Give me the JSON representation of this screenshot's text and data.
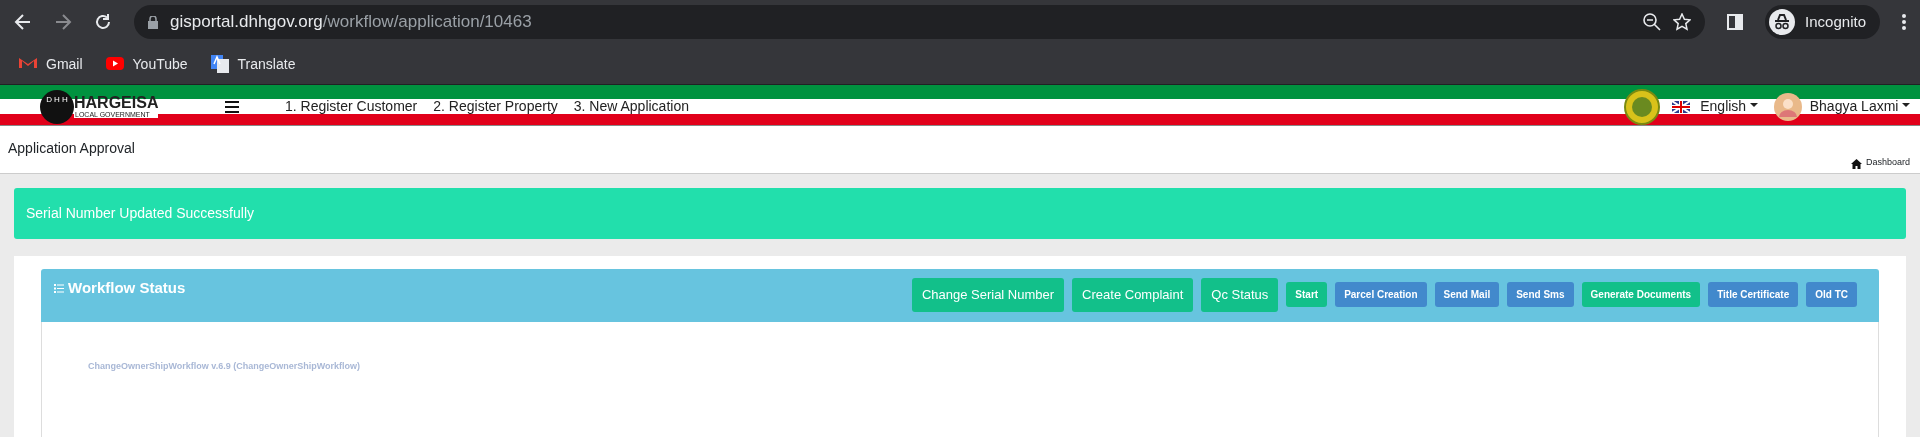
{
  "browser": {
    "url_host": "gisportal.dhhgov.org",
    "url_path": "/workflow/application/10463",
    "profile": "Incognito",
    "bookmarks": [
      {
        "label": "Gmail",
        "kind": "gmail"
      },
      {
        "label": "YouTube",
        "kind": "youtube"
      },
      {
        "label": "Translate",
        "kind": "translate"
      }
    ]
  },
  "header": {
    "logo_title": "HARGEISA",
    "logo_subtitle": "LOCAL GOVERNMENT",
    "logo_letters": [
      "D",
      "H",
      "H"
    ],
    "nav": [
      "1. Register Customer",
      "2. Register Property",
      "3. New Application"
    ],
    "language": "English",
    "user": "Bhagya Laxmi"
  },
  "page": {
    "title": "Application Approval",
    "breadcrumb": "Dashboard"
  },
  "alert": "Serial Number Updated Successfully",
  "panel": {
    "title": "Workflow Status",
    "buttons": [
      {
        "label": "Change Serial Number",
        "kind": "main"
      },
      {
        "label": "Create Complaint",
        "kind": "main"
      },
      {
        "label": "Qc Status",
        "kind": "main"
      },
      {
        "label": "Start",
        "kind": "success"
      },
      {
        "label": "Parcel Creation",
        "kind": "primary"
      },
      {
        "label": "Send Mail",
        "kind": "primary"
      },
      {
        "label": "Send Sms",
        "kind": "primary"
      },
      {
        "label": "Generate Documents",
        "kind": "success"
      },
      {
        "label": "Title Certificate",
        "kind": "primary"
      },
      {
        "label": "Old TC",
        "kind": "primary"
      }
    ],
    "workflow": "ChangeOwnerShipWorkflow v.6.9 (ChangeOwnerShipWorkflow)"
  }
}
